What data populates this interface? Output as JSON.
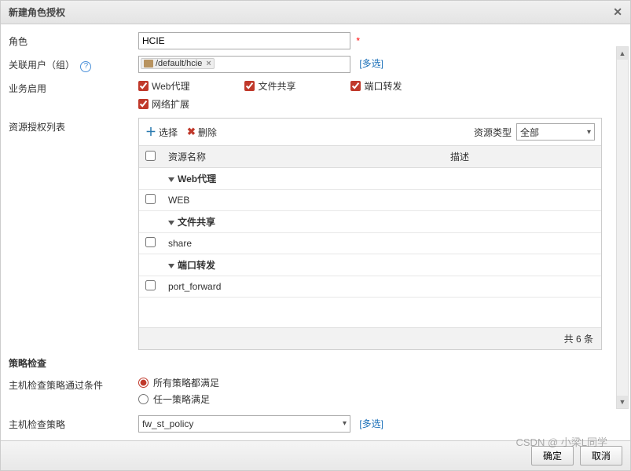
{
  "dialog": {
    "title": "新建角色授权"
  },
  "labels": {
    "role": "角色",
    "user_group": "关联用户（组）",
    "biz_enable": "业务启用",
    "resource_list": "资源授权列表",
    "policy_check": "策略检查",
    "host_check_cond": "主机检查策略通过条件",
    "host_check_policy": "主机检查策略"
  },
  "role": {
    "value": "HCIE"
  },
  "user_group": {
    "tag": "/default/hcie",
    "more": "[多选]"
  },
  "biz": {
    "web_proxy": "Web代理",
    "file_share": "文件共享",
    "port_fwd": "端口转发",
    "net_ext": "网络扩展"
  },
  "toolbar": {
    "select": "选择",
    "delete": "删除",
    "res_type_label": "资源类型",
    "res_type_value": "全部"
  },
  "table": {
    "col_name": "资源名称",
    "col_desc": "描述",
    "rows": [
      {
        "type": "group",
        "label": "Web代理"
      },
      {
        "type": "item",
        "label": "WEB"
      },
      {
        "type": "group",
        "label": "文件共享"
      },
      {
        "type": "item",
        "label": "share"
      },
      {
        "type": "group",
        "label": "端口转发"
      },
      {
        "type": "item",
        "label": "port_forward"
      }
    ],
    "footer": "共 6 条"
  },
  "policy": {
    "radio_all": "所有策略都满足",
    "radio_any": "任一策略满足",
    "select_value": "fw_st_policy",
    "more": "[多选]"
  },
  "buttons": {
    "ok": "确定",
    "cancel": "取消"
  },
  "watermark": "CSDN @ 小梁L同学"
}
